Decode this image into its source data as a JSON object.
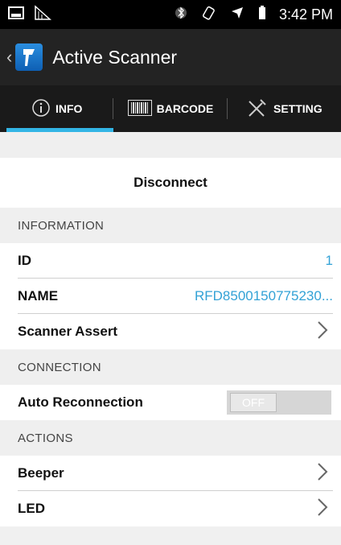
{
  "statusbar": {
    "time": "3:42 PM"
  },
  "app": {
    "title": "Active Scanner"
  },
  "tabs": [
    {
      "label": "INFO"
    },
    {
      "label": "BARCODE"
    },
    {
      "label": "SETTING"
    }
  ],
  "disconnect_label": "Disconnect",
  "sections": {
    "information": {
      "title": "INFORMATION",
      "id": {
        "label": "ID",
        "value": "1"
      },
      "name": {
        "label": "NAME",
        "value": "RFD8500150775230..."
      },
      "scanner_assert": {
        "label": "Scanner Assert"
      }
    },
    "connection": {
      "title": "CONNECTION",
      "auto_reconnection": {
        "label": "Auto Reconnection",
        "state": "OFF"
      }
    },
    "actions": {
      "title": "ACTIONS",
      "beeper": {
        "label": "Beeper"
      },
      "led": {
        "label": "LED"
      }
    }
  },
  "colors": {
    "accent": "#33b5e5",
    "value_text": "#33a2d6"
  }
}
